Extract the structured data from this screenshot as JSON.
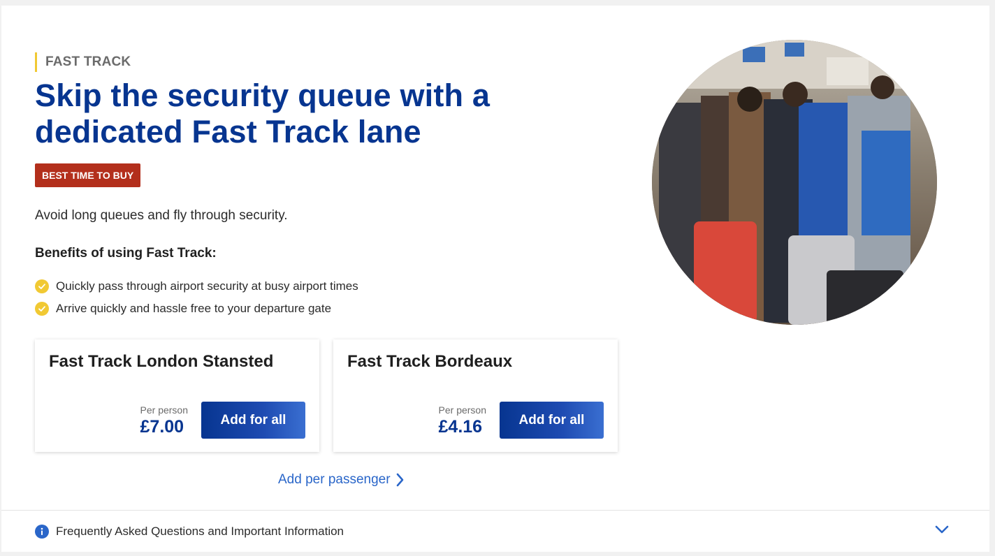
{
  "eyebrow": "FAST TRACK",
  "headline": "Skip the security queue with a dedicated Fast Track lane",
  "badge": "BEST TIME TO BUY",
  "intro": "Avoid long queues and fly through security.",
  "benefits_title": "Benefits of using Fast Track:",
  "benefits": [
    "Quickly pass through airport security at busy airport times",
    "Arrive quickly and hassle free to your departure gate"
  ],
  "cards": [
    {
      "title": "Fast Track London Stansted",
      "per_person": "Per person",
      "price": "£7.00",
      "button": "Add for all"
    },
    {
      "title": "Fast Track Bordeaux",
      "per_person": "Per person",
      "price": "£4.16",
      "button": "Add for all"
    }
  ],
  "per_passenger_link": "Add per passenger",
  "faq_label": "Frequently Asked Questions and Important Information",
  "colors": {
    "brand_blue": "#073590",
    "accent_yellow": "#f1c933",
    "badge_red": "#b32f1c",
    "link_blue": "#2a66c9"
  },
  "icons": {
    "benefit": "check-circle-icon",
    "link": "chevron-right-icon",
    "faq": "info-icon",
    "faq_toggle": "chevron-down-icon"
  }
}
